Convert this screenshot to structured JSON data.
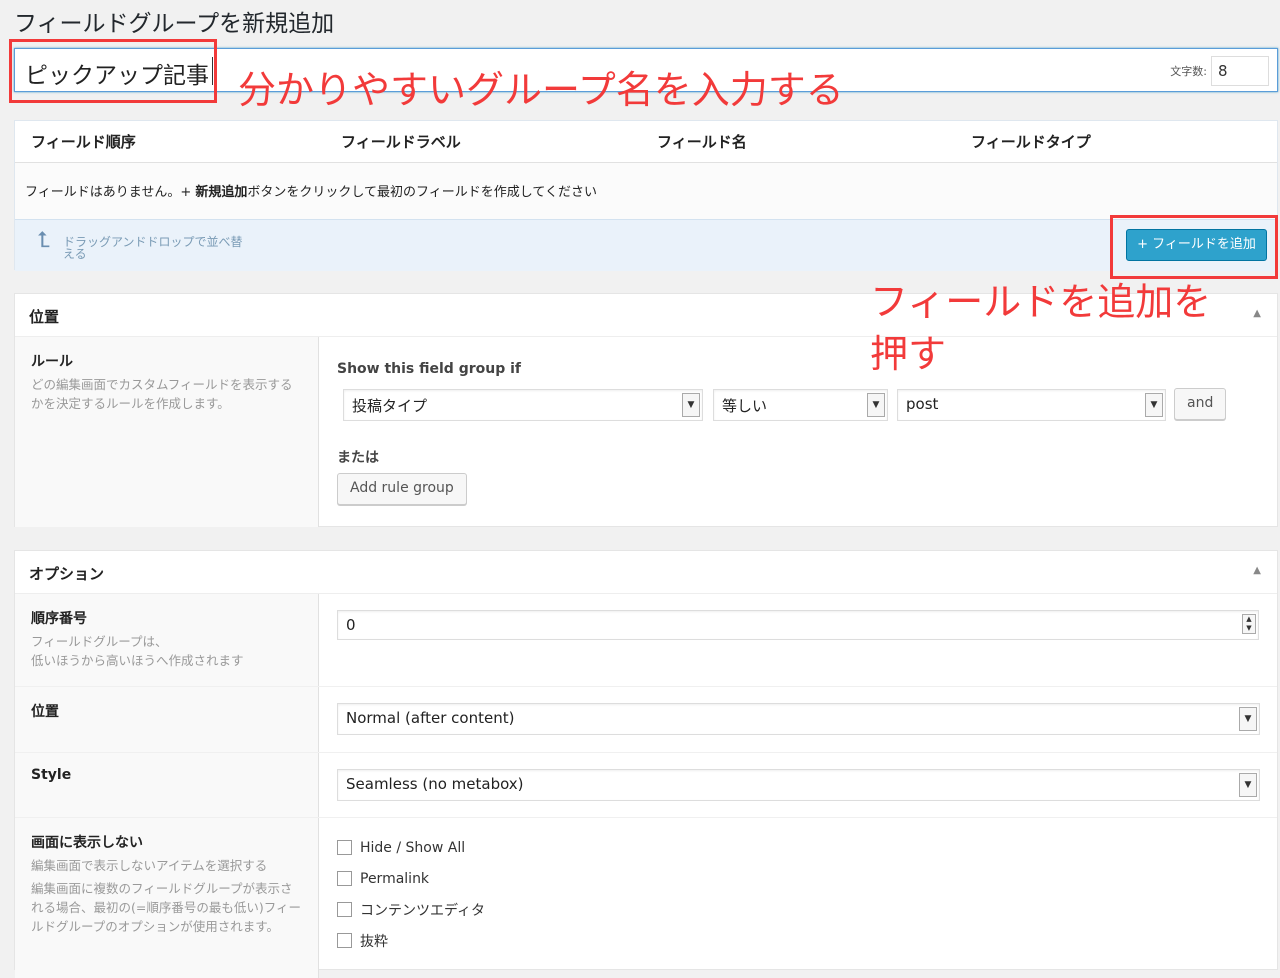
{
  "page_title": "フィールドグループを新規追加",
  "title_input": {
    "value": "ピックアップ記事",
    "char_count_label": "文字数:",
    "char_count": "8"
  },
  "annotations": {
    "group_name": "分かりやすいグループ名を入力する",
    "add_field_line1": "フィールドを追加を",
    "add_field_line2": "押す",
    "highlight_color": "#f23a3a"
  },
  "fields": {
    "columns": [
      "フィールド順序",
      "フィールドラベル",
      "フィールド名",
      "フィールドタイプ"
    ],
    "empty_prefix": "フィールドはありません。+ ",
    "empty_bold": "新規追加",
    "empty_suffix": "ボタンをクリックして最初のフィールドを作成してください",
    "drag_hint": "ドラッグアンドドロップで並べ替える",
    "add_button": "+ フィールドを追加",
    "accent": "#2ea2cc"
  },
  "location": {
    "title": "位置",
    "rules_label": "ルール",
    "rules_desc": "どの編集画面でカスタムフィールドを表示するかを決定するルールを作成します。",
    "show_if": "Show this field group if",
    "param": "投稿タイプ",
    "operator": "等しい",
    "value": "post",
    "and": "and",
    "or_label": "または",
    "add_rule_group": "Add rule group"
  },
  "options": {
    "title": "オプション",
    "order_label": "順序番号",
    "order_desc1": "フィールドグループは、",
    "order_desc2": "低いほうから高いほうへ作成されます",
    "order_value": "0",
    "position_label": "位置",
    "position_value": "Normal (after content)",
    "style_label": "Style",
    "style_value": "Seamless (no metabox)",
    "hide_label": "画面に表示しない",
    "hide_desc1": "編集画面で表示しないアイテムを選択する",
    "hide_desc2": "編集画面に複数のフィールドグループが表示される場合、最初の(=順序番号の最も低い)フィールドグループのオプションが使用されます。",
    "hide_items": [
      "Hide / Show All",
      "Permalink",
      "コンテンツエディタ",
      "抜粋"
    ]
  }
}
